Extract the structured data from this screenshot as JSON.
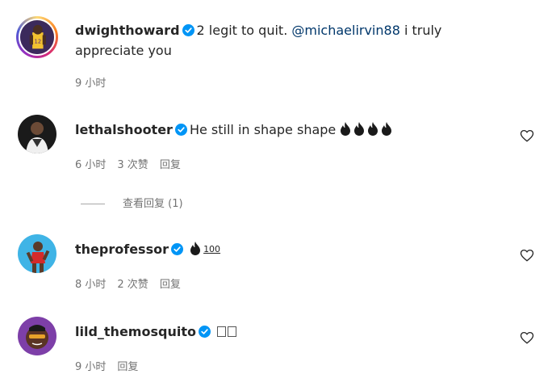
{
  "colors": {
    "text": "#262626",
    "meta": "#737373",
    "verified": "#0095f6",
    "mention": "#00376b"
  },
  "comments": [
    {
      "username": "dwighthoward",
      "verified": true,
      "text_before_mention": "2 legit to quit. ",
      "mention": "@michaelirvin88",
      "text_after_mention": " i truly appreciate you",
      "time": "9 小时",
      "avatar": "avatar-with-story-ring"
    },
    {
      "username": "lethalshooter",
      "verified": true,
      "text": "He still in shape shape",
      "emoji_icons": [
        "fire-icon",
        "fire-icon",
        "fire-icon",
        "fire-icon"
      ],
      "time": "6 小时",
      "likes": "3 次赞",
      "reply": "回复",
      "view_replies": "查看回复 (1)"
    },
    {
      "username": "theprofessor",
      "verified": true,
      "emoji_icons": [
        "fire-icon"
      ],
      "emoji_text": "100",
      "time": "8 小时",
      "likes": "2 次赞",
      "reply": "回复"
    },
    {
      "username": "lild_themosquito",
      "verified": true,
      "missing_glyphs": [
        "box",
        "box"
      ],
      "time": "9 小时",
      "reply": "回复"
    }
  ]
}
